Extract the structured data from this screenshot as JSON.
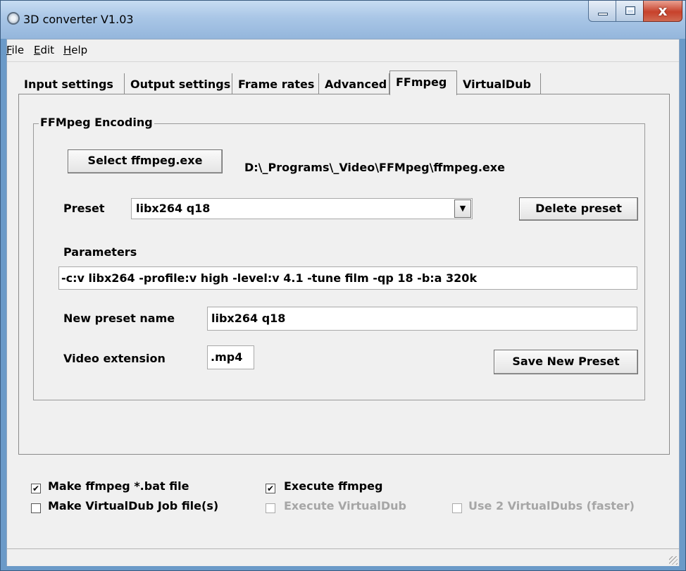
{
  "window": {
    "title": "3D converter V1.03",
    "close_glyph": "x"
  },
  "menu": [
    {
      "label": "File",
      "accel": "F",
      "rest": "ile"
    },
    {
      "label": "Edit",
      "accel": "E",
      "rest": "dit"
    },
    {
      "label": "Help",
      "accel": "H",
      "rest": "elp"
    }
  ],
  "tabs": [
    "Input settings",
    "Output settings",
    "Frame rates",
    "Advanced",
    "FFmpeg",
    "VirtualDub"
  ],
  "active_tab": "FFmpeg",
  "group": {
    "title": "FFMpeg Encoding",
    "select_button": "Select ffmpeg.exe",
    "exe_path": "D:\\_Programs\\_Video\\FFMpeg\\ffmpeg.exe",
    "preset_label": "Preset",
    "preset_value": "libx264 q18",
    "combo_arrow": "▼",
    "delete_button": "Delete preset",
    "parameters_label": "Parameters",
    "parameters_value": "-c:v libx264 -profile:v high -level:v 4.1 -tune film -qp 18 -b:a 320k",
    "new_preset_label": "New preset name",
    "new_preset_value": "libx264 q18",
    "extension_label": "Video extension",
    "extension_value": ".mp4",
    "save_button": "Save New Preset"
  },
  "options": [
    {
      "label": "Make ffmpeg *.bat file",
      "checked": true,
      "enabled": true
    },
    {
      "label": "Execute ffmpeg",
      "checked": true,
      "enabled": true
    },
    {
      "label": "Make VirtualDub Job file(s)",
      "checked": false,
      "enabled": true
    },
    {
      "label": "Execute VirtualDub",
      "checked": false,
      "enabled": false
    },
    {
      "label": "Use 2 VirtualDubs (faster)",
      "checked": false,
      "enabled": false
    }
  ],
  "check_glyph": "✔"
}
